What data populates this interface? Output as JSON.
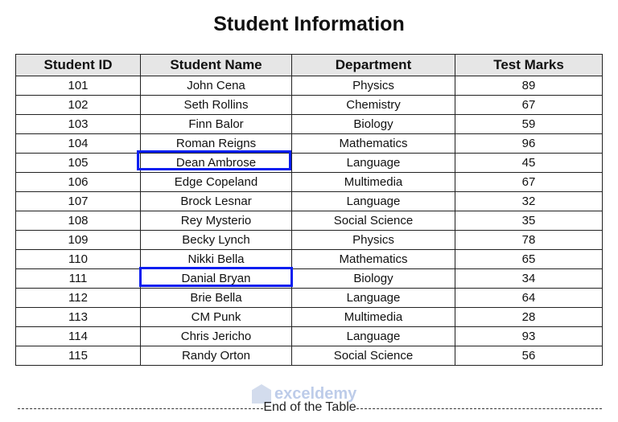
{
  "title": "Student Information",
  "headers": [
    "Student ID",
    "Student Name",
    "Department",
    "Test Marks"
  ],
  "rows": [
    [
      "101",
      "John Cena",
      "Physics",
      "89"
    ],
    [
      "102",
      "Seth Rollins",
      "Chemistry",
      "67"
    ],
    [
      "103",
      "Finn Balor",
      "Biology",
      "59"
    ],
    [
      "104",
      "Roman Reigns",
      "Mathematics",
      "96"
    ],
    [
      "105",
      "Dean Ambrose",
      "Language",
      "45"
    ],
    [
      "106",
      "Edge Copeland",
      "Multimedia",
      "67"
    ],
    [
      "107",
      "Brock Lesnar",
      "Language",
      "32"
    ],
    [
      "108",
      "Rey Mysterio",
      "Social Science",
      "35"
    ],
    [
      "109",
      "Becky Lynch",
      "Physics",
      "78"
    ],
    [
      "110",
      "Nikki Bella",
      "Mathematics",
      "65"
    ],
    [
      "111",
      "Danial Bryan",
      "Biology",
      "34"
    ],
    [
      "112",
      "Brie Bella",
      "Language",
      "64"
    ],
    [
      "113",
      "CM Punk",
      "Multimedia",
      "28"
    ],
    [
      "114",
      "Chris Jericho",
      "Language",
      "93"
    ],
    [
      "115",
      "Randy Orton",
      "Social Science",
      "56"
    ]
  ],
  "highlighted_names": [
    "Dean Ambrose",
    "Danial Bryan"
  ],
  "highlight_color": "#0a1ef0",
  "footer": "End of the Table",
  "watermark": "exceldemy"
}
